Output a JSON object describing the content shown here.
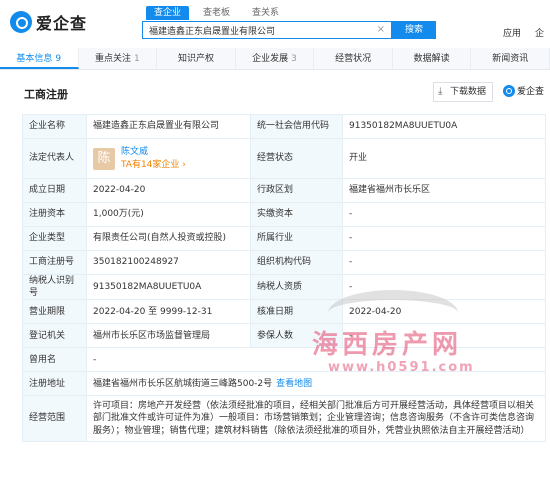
{
  "header": {
    "logo_text": "爱企查",
    "search_tabs": [
      "查企业",
      "查老板",
      "查关系"
    ],
    "search_value": "福建造鑫正东启晟置业有限公司",
    "clear_glyph": "×",
    "search_button": "搜索",
    "right_items": [
      "应用",
      "企"
    ]
  },
  "nav": {
    "tabs": [
      {
        "label": "基本信息",
        "count": "9"
      },
      {
        "label": "重点关注",
        "count": "1"
      },
      {
        "label": "知识产权",
        "count": ""
      },
      {
        "label": "企业发展",
        "count": "3"
      },
      {
        "label": "经营状况",
        "count": ""
      },
      {
        "label": "数据解读",
        "count": ""
      },
      {
        "label": "新闻资讯",
        "count": ""
      }
    ]
  },
  "section": {
    "title": "工商注册",
    "download_label": "下载数据",
    "brand_label": "爱企查"
  },
  "info": {
    "company_name_label": "企业名称",
    "company_name": "福建造鑫正东启晟置业有限公司",
    "credit_code_label": "统一社会信用代码",
    "credit_code": "91350182MA8UUETU0A",
    "legal_rep_label": "法定代表人",
    "legal_rep_avatar": "陈",
    "legal_rep_name": "陈文威",
    "legal_rep_sub": "TA有14家企业 ›",
    "status_label": "经营状态",
    "status": "开业",
    "established_label": "成立日期",
    "established": "2022-04-20",
    "district_label": "行政区划",
    "district": "福建省福州市长乐区",
    "reg_capital_label": "注册资本",
    "reg_capital": "1,000万(元)",
    "paid_capital_label": "实缴资本",
    "paid_capital": "-",
    "company_type_label": "企业类型",
    "company_type": "有限责任公司(自然人投资或控股)",
    "industry_label": "所属行业",
    "industry": "-",
    "reg_no_label": "工商注册号",
    "reg_no": "350182100248927",
    "org_code_label": "组织机构代码",
    "org_code": "-",
    "taxpayer_id_label": "纳税人识别号",
    "taxpayer_id": "91350182MA8UUETU0A",
    "taxpayer_qual_label": "纳税人资质",
    "taxpayer_qual": "-",
    "term_label": "营业期限",
    "term": "2022-04-20 至 9999-12-31",
    "approval_date_label": "核准日期",
    "approval_date": "2022-04-20",
    "authority_label": "登记机关",
    "authority": "福州市长乐区市场监督管理局",
    "insured_label": "参保人数",
    "insured": "-",
    "former_name_label": "曾用名",
    "former_name": "-",
    "address_label": "注册地址",
    "address": "福建省福州市长乐区航城街道三峰路500-2号",
    "address_map": "查看地图",
    "scope_label": "经营范围",
    "scope": "许可项目：房地产开发经营（依法须经批准的项目，经相关部门批准后方可开展经营活动，具体经营项目以相关部门批准文件或许可证件为准）一般项目：市场营销策划；企业管理咨询；信息咨询服务（不含许可类信息咨询服务）；物业管理；销售代理；建筑材料销售（除依法须经批准的项目外，凭营业执照依法自主开展经营活动）"
  },
  "watermark": {
    "cn": "海西房产网",
    "url": "www.h0591.com"
  }
}
